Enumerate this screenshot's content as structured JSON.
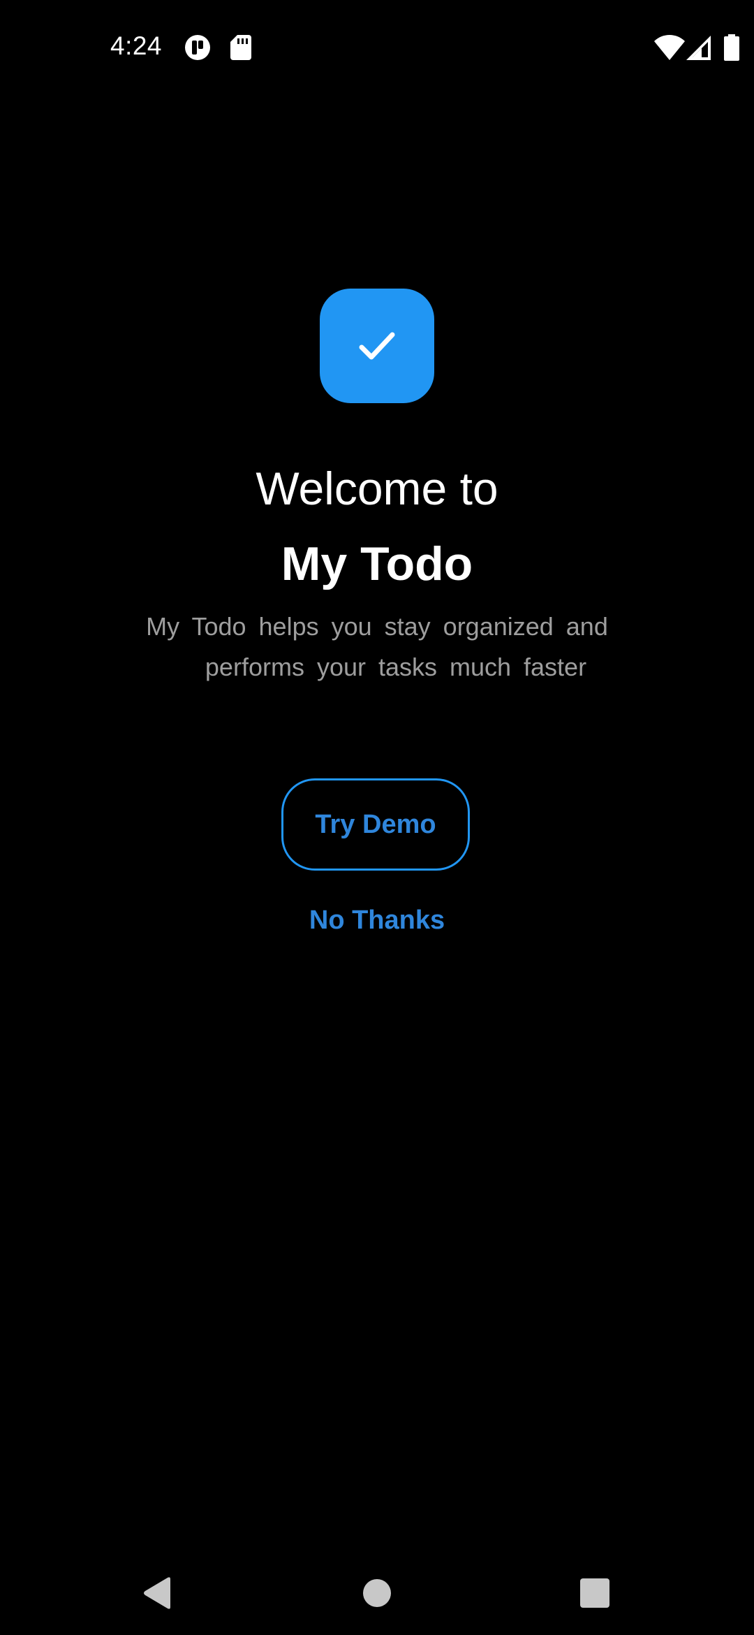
{
  "status_bar": {
    "time": "4:24",
    "icons": [
      "app-notification-icon",
      "sdcard-icon",
      "wifi-icon",
      "cell-signal-icon",
      "battery-icon"
    ]
  },
  "colors": {
    "background": "#000000",
    "accent": "#2196F3",
    "link_text": "#2F86DC",
    "body_text": "#9e9e9e",
    "heading_text": "#ffffff"
  },
  "onboarding": {
    "logo_icon": "checkmark-icon",
    "welcome_line": "Welcome to",
    "app_name": "My Todo",
    "tagline_line1": "My Todo helps you stay organized and",
    "tagline_line2": "performs your tasks much faster",
    "primary_button_label": "Try Demo",
    "secondary_link_label": "No Thanks"
  },
  "navigation_bar": {
    "buttons": [
      "back-icon",
      "home-icon",
      "recents-icon"
    ]
  }
}
